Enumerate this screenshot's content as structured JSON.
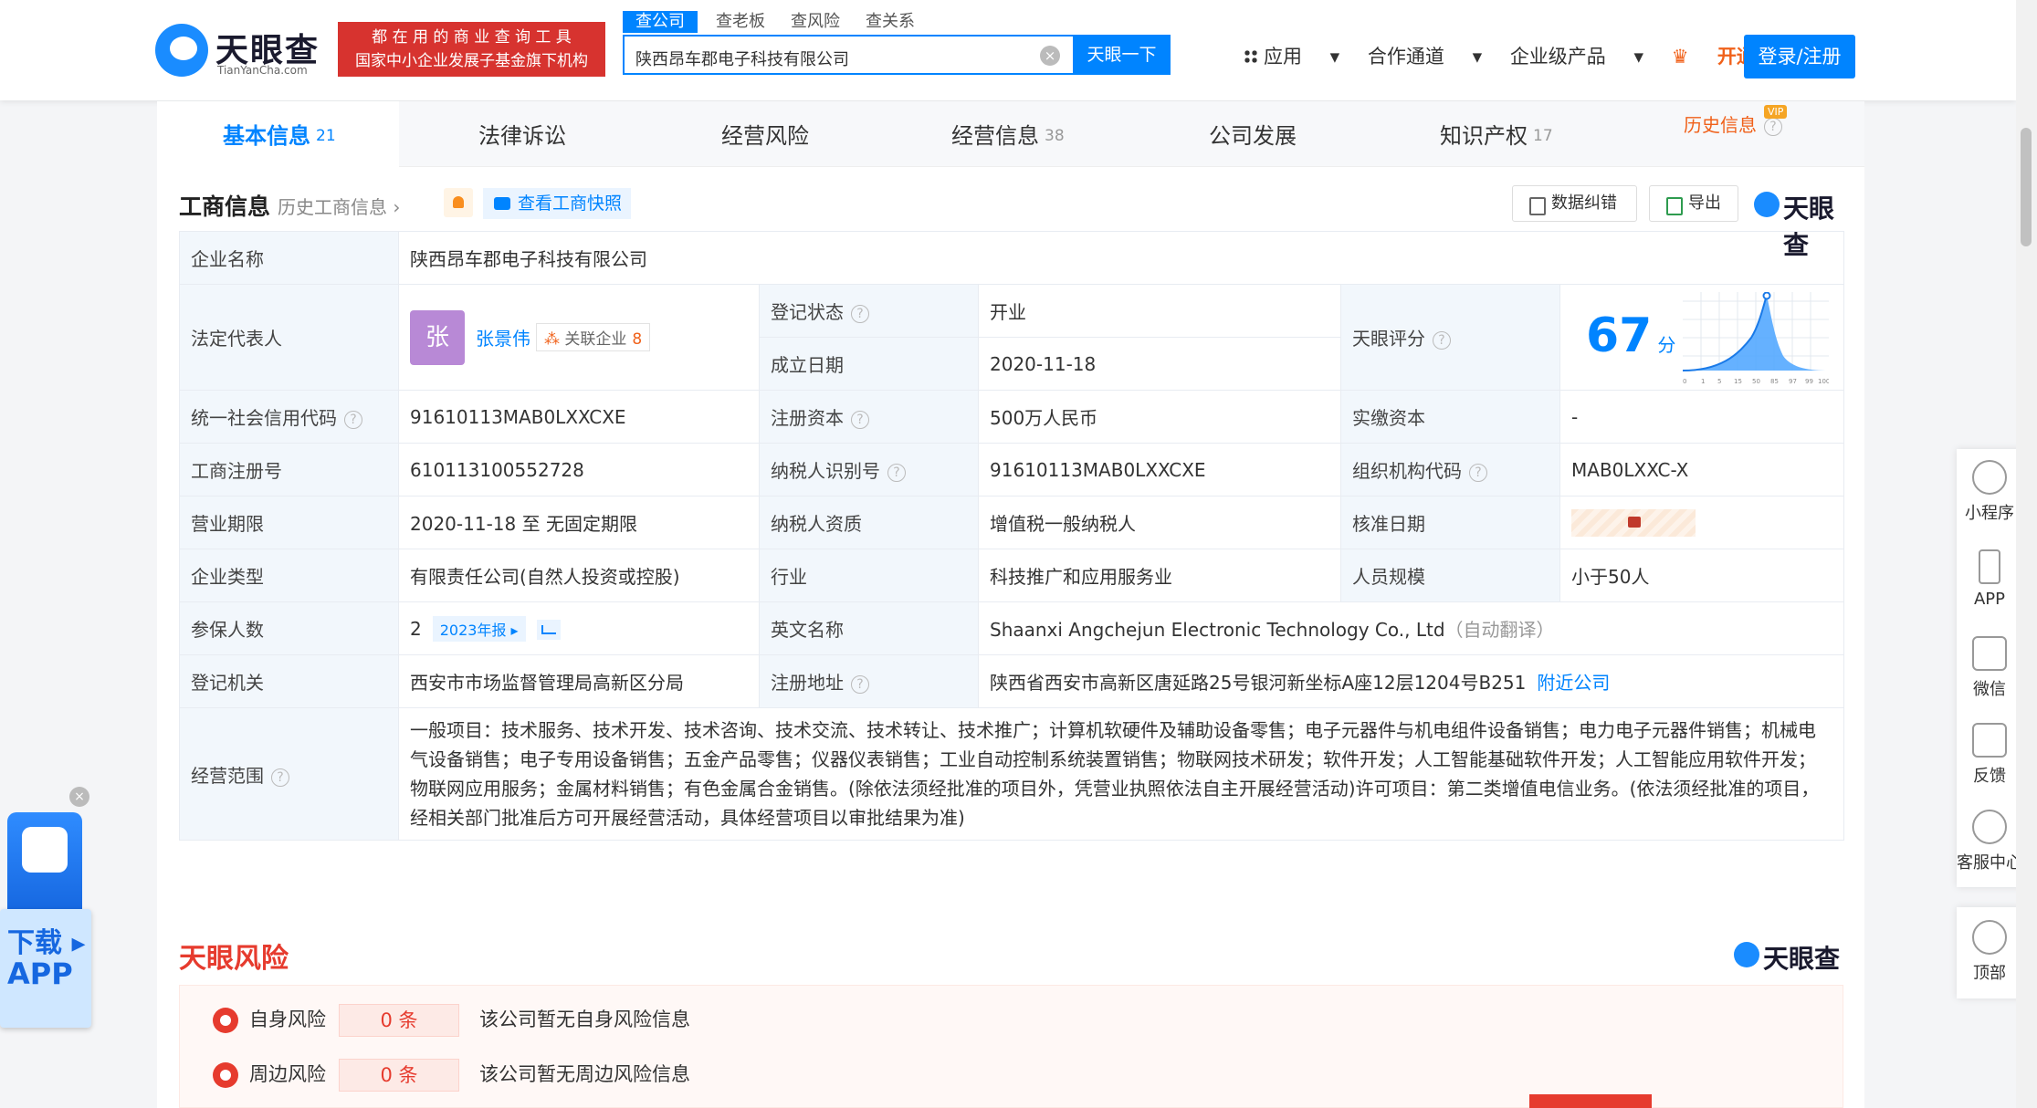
{
  "header": {
    "logo_cn": "天眼查",
    "logo_en": "TianYanCha.com",
    "badge_line1": "都 在 用 的 商 业 查 询 工 具",
    "badge_line2": "国家中小企业发展子基金旗下机构",
    "search_tabs": [
      "查公司",
      "查老板",
      "查风险",
      "查关系"
    ],
    "search_value": "陕西昂车郡电子科技有限公司",
    "search_button": "天眼一下",
    "nav_apps": "应用",
    "nav_partner": "合作通道",
    "nav_enterprise": "企业级产品",
    "nav_vip": "开通会员",
    "login": "登录/注册"
  },
  "tabs": [
    {
      "label": "基本信息",
      "count": "21"
    },
    {
      "label": "法律诉讼",
      "count": ""
    },
    {
      "label": "经营风险",
      "count": ""
    },
    {
      "label": "经营信息",
      "count": "38"
    },
    {
      "label": "公司发展",
      "count": ""
    },
    {
      "label": "知识产权",
      "count": "17"
    },
    {
      "label": "历史信息",
      "count": ""
    }
  ],
  "vip_tag": "VIP",
  "section": {
    "title": "工商信息",
    "history_link": "历史工商信息",
    "snapshot": "查看工商快照",
    "correct_btn": "数据纠错",
    "export_btn": "导出",
    "brand": "天眼查"
  },
  "info": {
    "name_k": "企业名称",
    "name_v": "陕西昂车郡电子科技有限公司",
    "legal_k": "法定代表人",
    "legal_avatar": "张",
    "legal_name": "张景伟",
    "related_label": "关联企业",
    "related_count": "8",
    "status_k": "登记状态",
    "status_v": "开业",
    "found_k": "成立日期",
    "found_v": "2020-11-18",
    "score_k": "天眼评分",
    "score_v": "67",
    "score_unit": "分",
    "credit_k": "统一社会信用代码",
    "credit_v": "91610113MAB0LXXCXE",
    "capital_k": "注册资本",
    "capital_v": "500万人民币",
    "paid_k": "实缴资本",
    "paid_v": "-",
    "reg_k": "工商注册号",
    "reg_v": "610113100552728",
    "tax_k": "纳税人识别号",
    "tax_v": "91610113MAB0LXXCXE",
    "org_k": "组织机构代码",
    "org_v": "MAB0LXXC-X",
    "term_k": "营业期限",
    "term_v": "2020-11-18 至 无固定期限",
    "taxq_k": "纳税人资质",
    "taxq_v": "增值税一般纳税人",
    "approve_k": "核准日期",
    "type_k": "企业类型",
    "type_v": "有限责任公司(自然人投资或控股)",
    "industry_k": "行业",
    "industry_v": "科技推广和应用服务业",
    "staff_k": "人员规模",
    "staff_v": "小于50人",
    "insured_k": "参保人数",
    "insured_v": "2",
    "insured_year": "2023年报",
    "en_k": "英文名称",
    "en_v": "Shaanxi Angchejun Electronic Technology Co., Ltd",
    "en_note": "（自动翻译）",
    "authority_k": "登记机关",
    "authority_v": "西安市市场监督管理局高新区分局",
    "addr_k": "注册地址",
    "addr_v": "陕西省西安市高新区唐延路25号银河新坐标A座12层1204号B251",
    "addr_link": "附近公司",
    "scope_k": "经营范围",
    "scope_v": "一般项目：技术服务、技术开发、技术咨询、技术交流、技术转让、技术推广；计算机软硬件及辅助设备零售；电子元器件与机电组件设备销售；电力电子元器件销售；机械电气设备销售；电子专用设备销售；五金产品零售；仪器仪表销售；工业自动控制系统装置销售；物联网技术研发；软件开发；人工智能基础软件开发；人工智能应用软件开发；物联网应用服务；金属材料销售；有色金属合金销售。(除依法须经批准的项目外，凭营业执照依法自主开展经营活动)许可项目：第二类增值电信业务。(依法须经批准的项目，经相关部门批准后方可开展经营活动，具体经营项目以审批结果为准)"
  },
  "score_axis": [
    "0",
    "1",
    "5",
    "15",
    "50",
    "85",
    "97",
    "99",
    "100"
  ],
  "risk": {
    "title": "天眼风险",
    "brand": "天眼查",
    "self_label": "自身风险",
    "self_count": "0 条",
    "self_text": "该公司暂无自身风险信息",
    "around_label": "周边风险",
    "around_count": "0 条",
    "around_text": "该公司暂无周边风险信息"
  },
  "sidebar": {
    "mini": "小程序",
    "app": "APP",
    "wechat": "微信",
    "feedback": "反馈",
    "service": "客服中心",
    "top": "顶部"
  },
  "download": {
    "line1": "下载",
    "line2": "APP"
  }
}
